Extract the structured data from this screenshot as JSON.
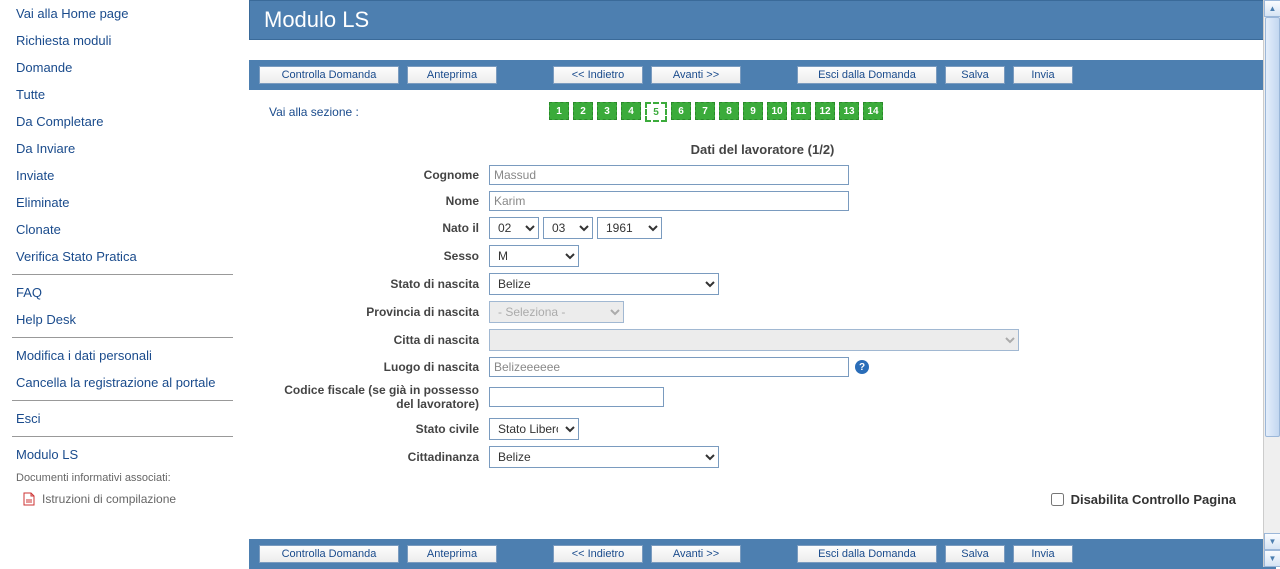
{
  "sidebar": {
    "home": "Vai alla Home page",
    "richiesta": "Richiesta moduli",
    "domande": "Domande",
    "items": [
      "Tutte",
      "Da Completare",
      "Da Inviare",
      "Inviate",
      "Eliminate",
      "Clonate"
    ],
    "verifica": "Verifica Stato Pratica",
    "faq": "FAQ",
    "helpdesk": "Help Desk",
    "modifica": "Modifica i dati personali",
    "cancella": "Cancella la registrazione al portale",
    "esci": "Esci",
    "modulo": "Modulo LS",
    "doc_label": "Documenti informativi associati:",
    "istruzioni": "Istruzioni di compilazione"
  },
  "header": {
    "title": "Modulo LS"
  },
  "toolbar": {
    "controlla": "Controlla Domanda",
    "anteprima": "Anteprima",
    "indietro": "<< Indietro",
    "avanti": "Avanti >>",
    "esci": "Esci dalla Domanda",
    "salva": "Salva",
    "invia": "Invia"
  },
  "nav": {
    "label": "Vai alla sezione :",
    "steps": [
      "1",
      "2",
      "3",
      "4",
      "5",
      "6",
      "7",
      "8",
      "9",
      "10",
      "11",
      "12",
      "13",
      "14"
    ],
    "current": "5"
  },
  "form": {
    "title": "Dati del lavoratore (1/2)",
    "labels": {
      "cognome": "Cognome",
      "nome": "Nome",
      "nato": "Nato il",
      "sesso": "Sesso",
      "stato_nascita": "Stato di nascita",
      "provincia_nascita": "Provincia di nascita",
      "citta_nascita": "Citta di nascita",
      "luogo_nascita": "Luogo di nascita",
      "codice_fiscale": "Codice fiscale (se già in possesso del lavoratore)",
      "stato_civile": "Stato civile",
      "cittadinanza": "Cittadinanza"
    },
    "values": {
      "cognome": "Massud",
      "nome": "Karim",
      "nato_gg": "02",
      "nato_mm": "03",
      "nato_aa": "1961",
      "sesso": "M",
      "stato_nascita": "Belize",
      "provincia_nascita": "- Seleziona -",
      "citta_nascita": "",
      "luogo_nascita": "Belizeeeeee",
      "codice_fiscale": "",
      "stato_civile": "Stato Libero",
      "cittadinanza": "Belize"
    },
    "checkbox_label": "Disabilita Controllo Pagina"
  }
}
